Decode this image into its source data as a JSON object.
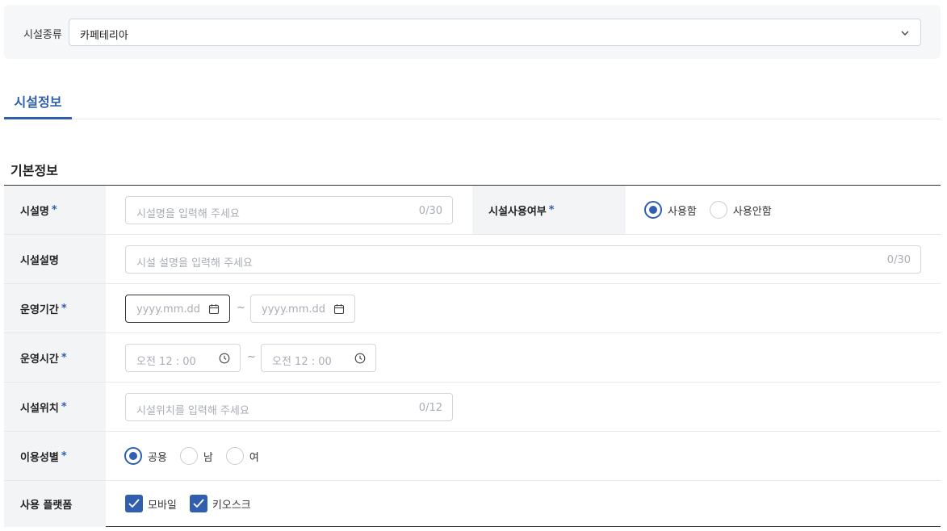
{
  "facility_type": {
    "label": "시설종류",
    "selected": "카페테리아"
  },
  "tabs": [
    {
      "label": "시설정보"
    }
  ],
  "section_title": "기본정보",
  "fields": {
    "name": {
      "label": "시설명",
      "required_mark": "*",
      "placeholder": "시설명을 입력해 주세요",
      "counter": "0/30"
    },
    "usage": {
      "label": "시설사용여부",
      "required_mark": "*",
      "options": [
        "사용함",
        "사용안함"
      ],
      "selected": "사용함"
    },
    "description": {
      "label": "시설설명",
      "placeholder": "시설 설명을 입력해 주세요",
      "counter": "0/30"
    },
    "period": {
      "label": "운영기간",
      "required_mark": "*",
      "start_placeholder": "yyyy.mm.dd",
      "separator": "~",
      "end_placeholder": "yyyy.mm.dd"
    },
    "hours": {
      "label": "운영시간",
      "required_mark": "*",
      "start_value": "오전 12 : 00",
      "separator": "~",
      "end_value": "오전 12 : 00"
    },
    "location": {
      "label": "시설위치",
      "required_mark": "*",
      "placeholder": "시설위치를 입력해 주세요",
      "counter": "0/12"
    },
    "gender": {
      "label": "이용성별",
      "required_mark": "*",
      "options": [
        "공용",
        "남",
        "여"
      ],
      "selected": "공용"
    },
    "platform": {
      "label": "사용 플랫폼",
      "options": [
        "모바일",
        "키오스크"
      ],
      "checked": [
        "모바일",
        "키오스크"
      ]
    }
  },
  "icons": {
    "select": "chevron-down-icon",
    "date": "calendar-icon",
    "time": "clock-icon",
    "check": "checkmark-icon"
  },
  "colors": {
    "accent": "#2f5fae",
    "header_bg": "#f3f4f6"
  }
}
